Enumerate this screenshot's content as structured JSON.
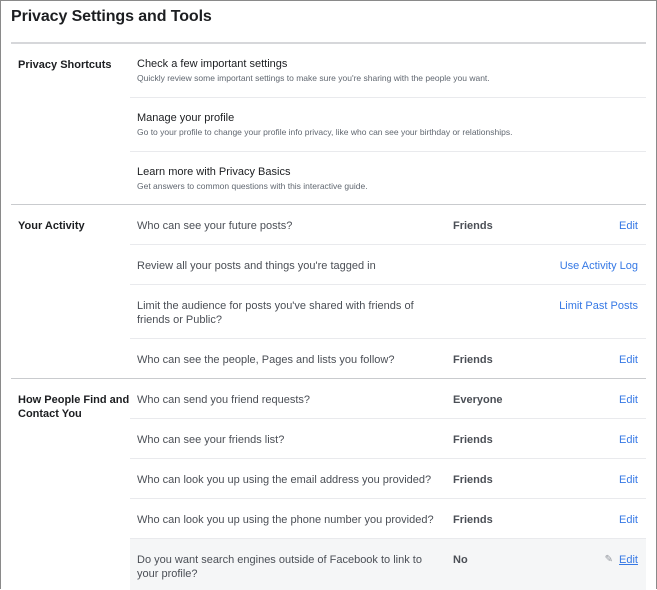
{
  "page": {
    "title": "Privacy Settings and Tools"
  },
  "sections": {
    "shortcuts": {
      "label": "Privacy Shortcuts",
      "items": [
        {
          "title": "Check a few important settings",
          "description": "Quickly review some important settings to make sure you're sharing with the people you want."
        },
        {
          "title": "Manage your profile",
          "description": "Go to your profile to change your profile info privacy, like who can see your birthday or relationships."
        },
        {
          "title": "Learn more with Privacy Basics",
          "description": "Get answers to common questions with this interactive guide."
        }
      ]
    },
    "activity": {
      "label": "Your Activity",
      "rows": [
        {
          "question": "Who can see your future posts?",
          "value": "Friends",
          "action": "Edit"
        },
        {
          "question": "Review all your posts and things you're tagged in",
          "value": "",
          "action": "Use Activity Log"
        },
        {
          "question": "Limit the audience for posts you've shared with friends of friends or Public?",
          "value": "",
          "action": "Limit Past Posts"
        },
        {
          "question": "Who can see the people, Pages and lists you follow?",
          "value": "Friends",
          "action": "Edit"
        }
      ]
    },
    "find_contact": {
      "label": "How People Find and Contact You",
      "rows": [
        {
          "question": "Who can send you friend requests?",
          "value": "Everyone",
          "action": "Edit"
        },
        {
          "question": "Who can see your friends list?",
          "value": "Friends",
          "action": "Edit"
        },
        {
          "question": "Who can look you up using the email address you provided?",
          "value": "Friends",
          "action": "Edit"
        },
        {
          "question": "Who can look you up using the phone number you provided?",
          "value": "Friends",
          "action": "Edit"
        },
        {
          "question": "Do you want search engines outside of Facebook to link to your profile?",
          "value": "No",
          "action": "Edit",
          "pencil_icon": "pencil-icon",
          "hovered": true
        }
      ]
    }
  },
  "colors": {
    "link": "#3578e5",
    "hover_row_bg": "#f5f6f7"
  }
}
